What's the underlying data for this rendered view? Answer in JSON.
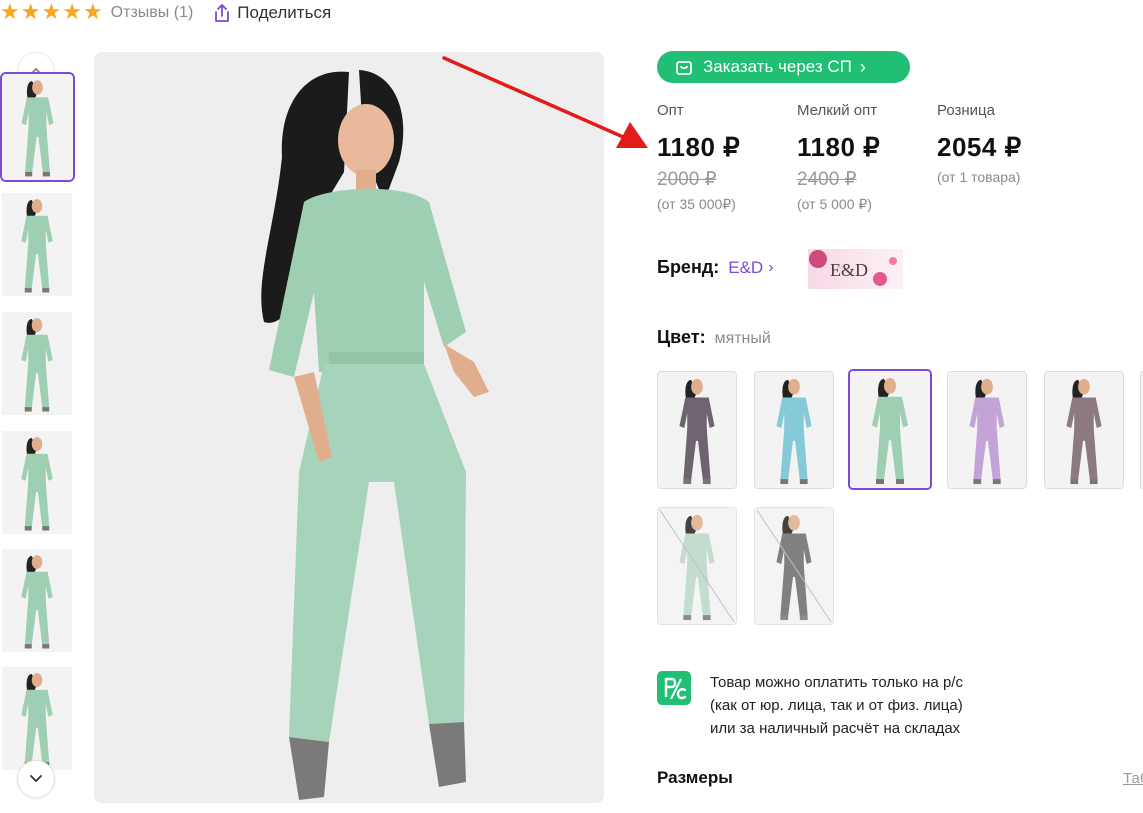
{
  "rating": {
    "stars": 5,
    "reviews_label": "Отзывы (1)"
  },
  "share": {
    "label": "Поделиться",
    "icon": "share-icon"
  },
  "gallery": {
    "thumbnail_count": 6,
    "active_index": 0,
    "up_icon": "chevron-up-icon",
    "down_icon": "chevron-down-icon"
  },
  "order_button": {
    "label": "Заказать через СП",
    "icon": "bag-icon"
  },
  "prices": [
    {
      "label": "Опт",
      "price": "1180 ₽",
      "old_price": "2000 ₽",
      "note": "(от 35 000₽)"
    },
    {
      "label": "Мелкий опт",
      "price": "1180 ₽",
      "old_price": "2400 ₽",
      "note": "(от 5 000 ₽)"
    },
    {
      "label": "Розница",
      "price": "2054 ₽",
      "old_price": "",
      "note": "(от 1 товара)"
    }
  ],
  "brand": {
    "label": "Бренд:",
    "name": "E&D",
    "logo_text": "E&D"
  },
  "color": {
    "label": "Цвет:",
    "value": "мятный",
    "swatches": [
      {
        "color": "#6e6470",
        "available": true,
        "selected": false
      },
      {
        "color": "#86c9d8",
        "available": true,
        "selected": false
      },
      {
        "color": "#9fcfb3",
        "available": true,
        "selected": true
      },
      {
        "color": "#c3a3d8",
        "available": true,
        "selected": false
      },
      {
        "color": "#8d7a80",
        "available": true,
        "selected": false
      },
      {
        "color": "#b9d6c6",
        "available": false,
        "selected": false
      },
      {
        "color": "#6b6b6b",
        "available": false,
        "selected": false
      }
    ]
  },
  "payment": {
    "icon_text": "P/C",
    "lines": [
      "Товар можно оплатить только на р/с",
      "(как от юр. лица, так и от физ. лица)",
      "или за наличный расчёт на складах"
    ]
  },
  "sizes": {
    "label": "Размеры",
    "link": "Таб"
  },
  "colors": {
    "accent": "#7b4ad6",
    "green": "#21bf73",
    "star": "#f5a623",
    "arrow": "#e21b1b",
    "garment": "#9fcfb3"
  }
}
